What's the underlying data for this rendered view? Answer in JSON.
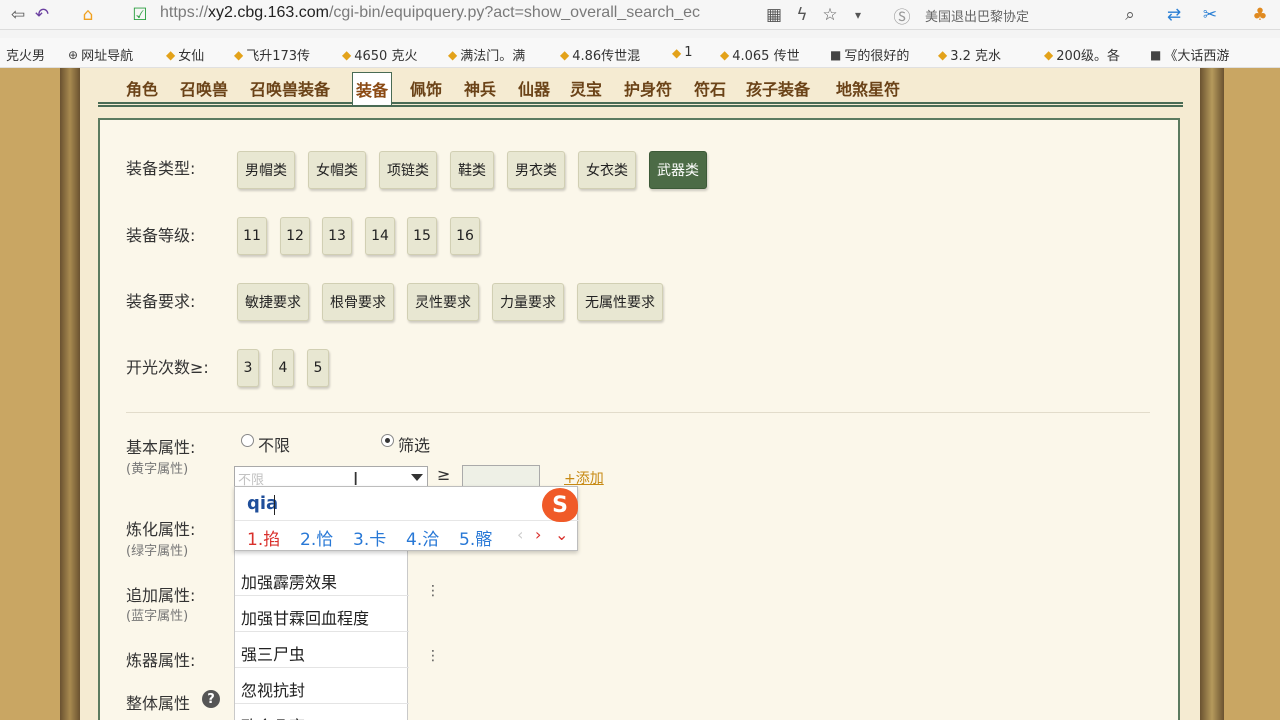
{
  "browser": {
    "url_scheme": "https://",
    "url_domain": "xy2.cbg.163.com",
    "url_path": "/cgi-bin/equipquery.py?act=show_overall_search_ec",
    "search_hint": "美国退出巴黎协定",
    "icons": {
      "back": "undo-icon",
      "home": "home-icon",
      "security": "shield-check-icon",
      "grid": "qr-grid-icon",
      "lightning": "lightning-icon",
      "star": "star-icon",
      "dropdown": "chevron-down-icon",
      "search_engine": "sogou-icon",
      "search": "search-icon",
      "sync": "sync-icon",
      "tools": "tools-icon",
      "extensions": "puzzle-icon"
    }
  },
  "bookmarks": [
    {
      "label": "克火男",
      "icon": "none"
    },
    {
      "label": "网址导航",
      "icon": "globe-icon"
    },
    {
      "label": "女仙",
      "icon": "bookmark-icon"
    },
    {
      "label": "飞升173传",
      "icon": "bookmark-icon"
    },
    {
      "label": "4650 克火",
      "icon": "bookmark-icon"
    },
    {
      "label": "满法门。满",
      "icon": "bookmark-icon"
    },
    {
      "label": "4.86传世混",
      "icon": "bookmark-icon"
    },
    {
      "label": "1",
      "icon": "bookmark-icon"
    },
    {
      "label": "4.065 传世",
      "icon": "bookmark-icon"
    },
    {
      "label": "写的很好的",
      "icon": "page-icon"
    },
    {
      "label": "3.2 克水",
      "icon": "bookmark-icon"
    },
    {
      "label": "200级。各",
      "icon": "bookmark-icon"
    },
    {
      "label": "《大话西游",
      "icon": "page-icon"
    }
  ],
  "tabs": [
    "角色",
    "召唤兽",
    "召唤兽装备",
    "装备",
    "佩饰",
    "神兵",
    "仙器",
    "灵宝",
    "护身符",
    "符石",
    "孩子装备",
    "地煞星符"
  ],
  "active_tab": "装备",
  "filters": {
    "equip_type": {
      "label": "装备类型:",
      "options": [
        "男帽类",
        "女帽类",
        "项链类",
        "鞋类",
        "男衣类",
        "女衣类",
        "武器类"
      ],
      "selected": "武器类"
    },
    "equip_level": {
      "label": "装备等级:",
      "options": [
        "11",
        "12",
        "13",
        "14",
        "15",
        "16"
      ]
    },
    "equip_req": {
      "label": "装备要求:",
      "options": [
        "敏捷要求",
        "根骨要求",
        "灵性要求",
        "力量要求",
        "无属性要求"
      ]
    },
    "open_count": {
      "label": "开光次数≥:",
      "options": [
        "3",
        "4",
        "5"
      ]
    }
  },
  "basic_attr": {
    "label": "基本属性:",
    "sub": "(黄字属性)",
    "radio_unlimited": "不限",
    "radio_filter": "筛选",
    "selected_radio": "筛选",
    "select_placeholder": "不限",
    "ge_symbol": "≥",
    "add_link": "+添加"
  },
  "refine_attr": {
    "label": "炼化属性:",
    "sub": "(绿字属性)"
  },
  "extra_attr": {
    "label": "追加属性:",
    "sub": "(蓝字属性)"
  },
  "forge_attr": {
    "label": "炼器属性:"
  },
  "overall_attr": {
    "label": "整体属性",
    "help_icon": "help-icon",
    "help_glyph": "?"
  },
  "dropdown_items": [
    "加强霹雳效果",
    "加强甘霖回血程度",
    "强三尸虫",
    "忽视抗封",
    "致命几率"
  ],
  "ime": {
    "composition": "qia",
    "candidates": [
      "1.掐",
      "2.恰",
      "3.卡",
      "4.洽",
      "5.髂"
    ],
    "logo_letter": "S"
  }
}
